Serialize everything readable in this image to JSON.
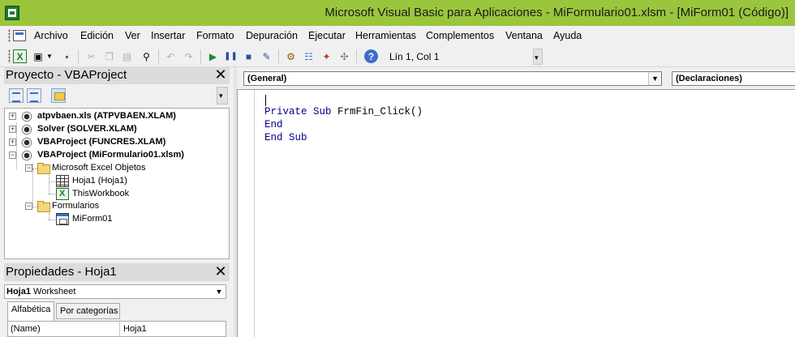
{
  "window": {
    "title": "Microsoft Visual Basic para Aplicaciones - MiFormulario01.xlsm - [MiForm01 (Código)]",
    "icon": "excel-vba-icon",
    "accent": "#9bc53d"
  },
  "menu": {
    "items": [
      "Archivo",
      "Edición",
      "Ver",
      "Insertar",
      "Formato",
      "Depuración",
      "Ejecutar",
      "Herramientas",
      "Complementos",
      "Ventana",
      "Ayuda"
    ]
  },
  "toolbar": {
    "position_text": "Lín 1, Col 1",
    "buttons": [
      "view-excel",
      "insert-dropdown",
      "save",
      "cut",
      "copy",
      "paste",
      "find",
      "undo",
      "redo",
      "run",
      "break",
      "reset",
      "design-mode",
      "project-explorer",
      "properties-window",
      "object-browser",
      "toolbox",
      "help"
    ]
  },
  "project_pane": {
    "title": "Proyecto - VBAProject",
    "close_glyph": "✕",
    "tree": [
      {
        "label": "atpvbaen.xls (ATPVBAEN.XLAM)",
        "expander": "+",
        "bold": true
      },
      {
        "label": "Solver (SOLVER.XLAM)",
        "expander": "+",
        "bold": true
      },
      {
        "label": "VBAProject (FUNCRES.XLAM)",
        "expander": "+",
        "bold": true
      },
      {
        "label": "VBAProject (MiFormulario01.xlsm)",
        "expander": "−",
        "bold": true
      },
      {
        "label": "Microsoft Excel Objetos",
        "expander": "−",
        "bold": false
      },
      {
        "label": "Hoja1 (Hoja1)",
        "expander": "",
        "bold": false
      },
      {
        "label": "ThisWorkbook",
        "expander": "",
        "bold": false
      },
      {
        "label": "Formularios",
        "expander": "−",
        "bold": false
      },
      {
        "label": "MiForm01",
        "expander": "",
        "bold": false
      }
    ]
  },
  "properties_pane": {
    "title": "Propiedades - Hoja1",
    "close_glyph": "✕",
    "object_name": "Hoja1",
    "object_type": "Worksheet",
    "tabs": [
      "Alfabética",
      "Por categorías"
    ],
    "rows": [
      {
        "key": "(Name)",
        "value": "Hoja1"
      }
    ]
  },
  "code_window": {
    "object_combo": "(General)",
    "procedure_combo": "(Declaraciones)",
    "lines": [
      [
        {
          "t": "Private Sub",
          "kw": true
        },
        {
          "t": " FrmFin_Click()",
          "kw": false
        }
      ],
      [
        {
          "t": "End",
          "kw": true
        }
      ],
      [
        {
          "t": "End Sub",
          "kw": true
        }
      ]
    ]
  }
}
